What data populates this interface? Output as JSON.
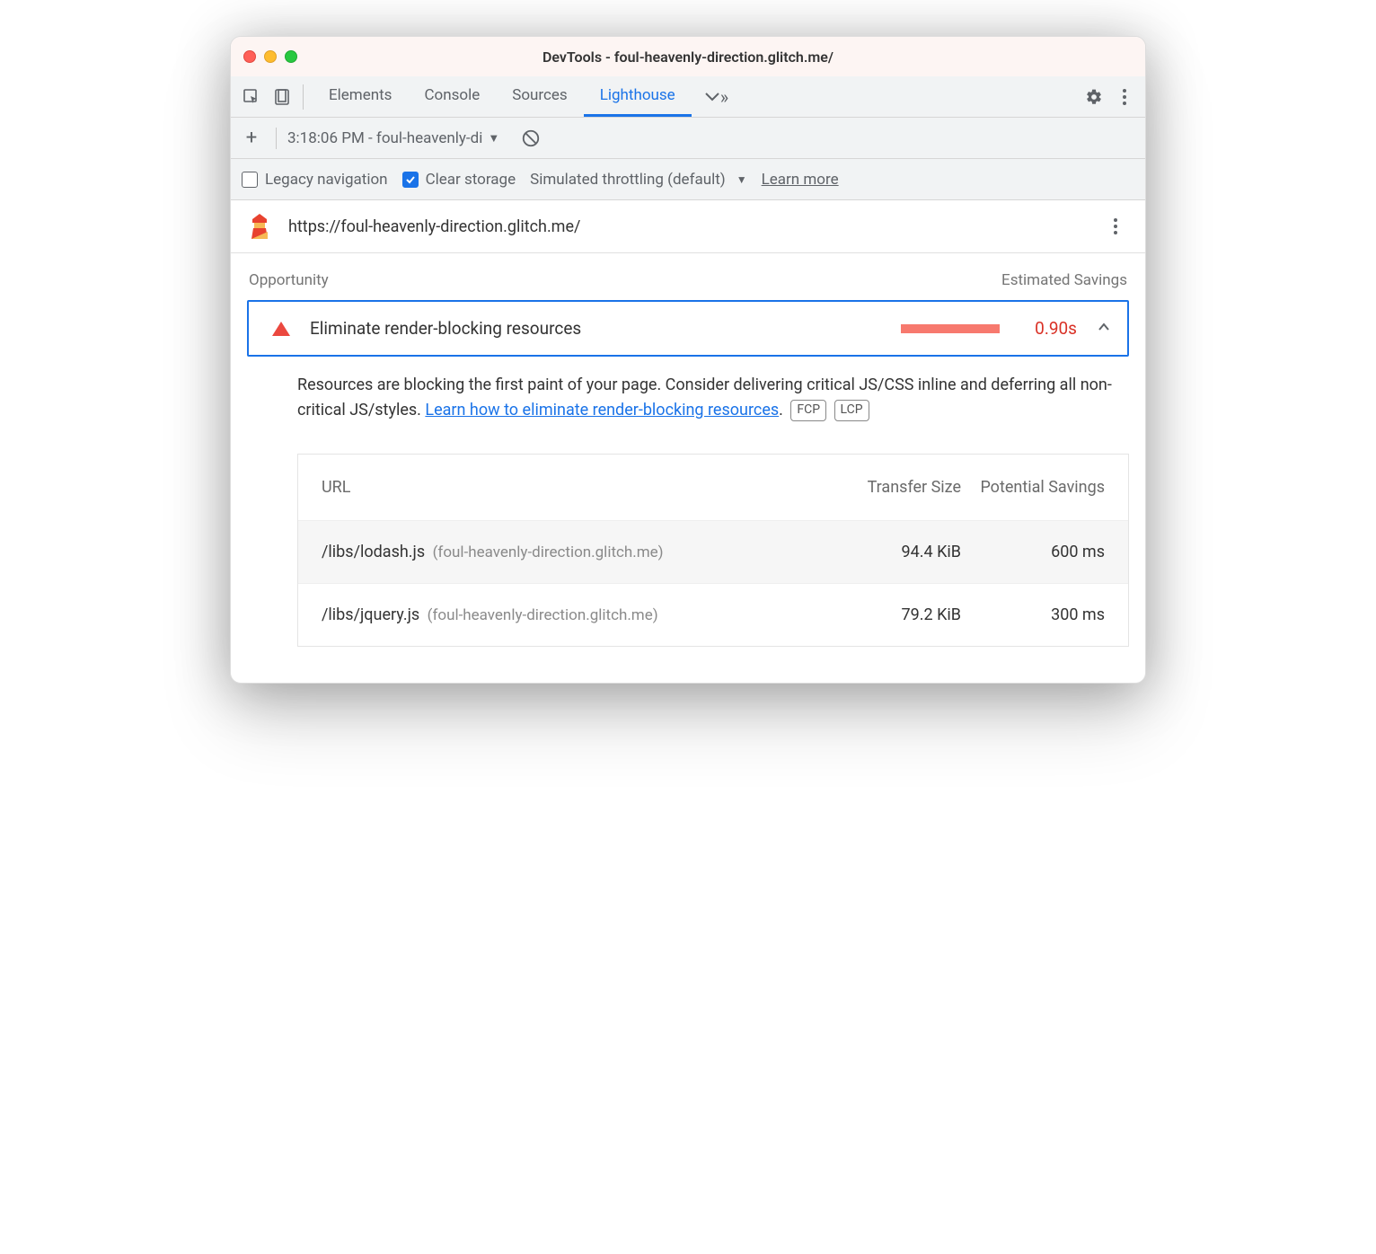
{
  "window": {
    "title": "DevTools - foul-heavenly-direction.glitch.me/"
  },
  "tabs": {
    "items": [
      "Elements",
      "Console",
      "Sources",
      "Lighthouse"
    ],
    "active_index": 3
  },
  "report_bar": {
    "dropdown_text": "3:18:06 PM - foul-heavenly-di"
  },
  "options": {
    "legacy_nav": {
      "label": "Legacy navigation",
      "checked": false
    },
    "clear_storage": {
      "label": "Clear storage",
      "checked": true
    },
    "throttling_label": "Simulated throttling (default)",
    "learn_more": "Learn more"
  },
  "url_bar": {
    "url": "https://foul-heavenly-direction.glitch.me/"
  },
  "section": {
    "opportunity_label": "Opportunity",
    "savings_label": "Estimated Savings"
  },
  "audit": {
    "title": "Eliminate render-blocking resources",
    "savings": "0.90s",
    "description_lead": "Resources are blocking the first paint of your page. Consider delivering critical JS/CSS inline and deferring all non-critical JS/styles. ",
    "learn_link": "Learn how to eliminate render-blocking resources",
    "description_tail": ".",
    "tags": [
      "FCP",
      "LCP"
    ]
  },
  "table": {
    "headers": {
      "url": "URL",
      "size": "Transfer Size",
      "savings": "Potential Savings"
    },
    "rows": [
      {
        "path": "/libs/lodash.js",
        "host": "(foul-heavenly-direction.glitch.me)",
        "size": "94.4 KiB",
        "savings": "600 ms"
      },
      {
        "path": "/libs/jquery.js",
        "host": "(foul-heavenly-direction.glitch.me)",
        "size": "79.2 KiB",
        "savings": "300 ms"
      }
    ]
  }
}
